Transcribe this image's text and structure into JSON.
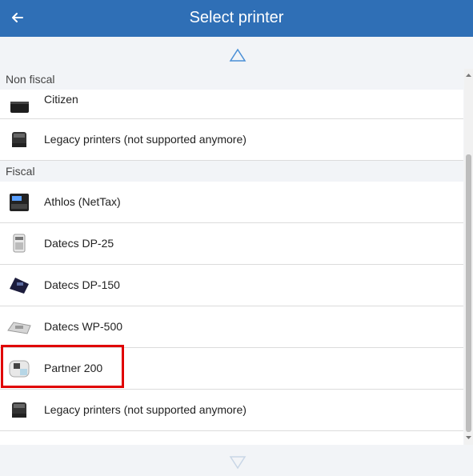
{
  "header": {
    "title": "Select printer",
    "back_icon": "arrow-left-icon"
  },
  "colors": {
    "header_bg": "#2f6fb6",
    "highlight": "#e00000"
  },
  "sections": [
    {
      "title": "Non fiscal",
      "items": [
        "Citizen",
        "Legacy printers (not supported anymore)"
      ]
    },
    {
      "title": "Fiscal",
      "items": [
        "Athlos (NetTax)",
        "Datecs DP-25",
        "Datecs DP-150",
        "Datecs WP-500",
        "Partner 200",
        "Legacy printers (not supported anymore)"
      ]
    }
  ]
}
